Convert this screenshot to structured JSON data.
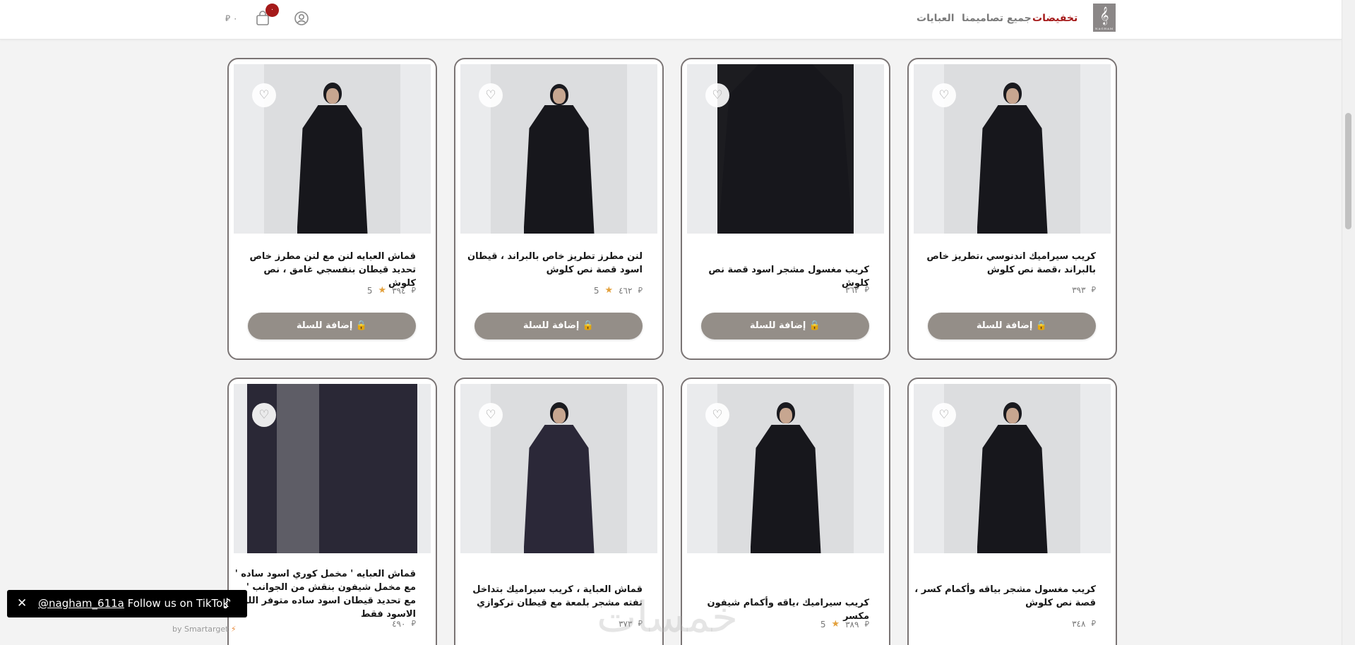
{
  "header": {
    "logo_mark": "𝄞",
    "logo_text": "NAGHAM",
    "nav": {
      "sale": "تخفيضات",
      "all_designs": "جميع تصاميمنا",
      "abayas": "العبايات"
    },
    "cart_count": "٠",
    "cart_total": "٠ ⃁",
    "icons": {
      "profile": "profile-icon",
      "cart": "shopping-bag-icon"
    }
  },
  "add_to_cart_label": "إضافة للسلة",
  "favorite_icon": "♡",
  "currency": "⃁",
  "star": "★",
  "products": [
    {
      "title": "كريب سيراميك اندنوسي ،تطريز خاص بالبراند ،قصة نص كلوش",
      "price": "٣٩٣",
      "rating": ""
    },
    {
      "title": "كريب مغسول مشجر اسود قصة نص كلوش",
      "price": "٣٦٢",
      "rating": ""
    },
    {
      "title": "لنن مطرز تطريز خاص بالبراند ، قيطان اسود قصة نص كلوش",
      "price": "٤٦٢",
      "rating": "5"
    },
    {
      "title": "قماش العبايه لنن مع لنن مطرز خاص تحديد قيطان بنفسجي غامق ، نص كلوش",
      "price": "٣٩٤",
      "rating": "5"
    },
    {
      "title": "كريب مغسول مشجر بياقه وأكمام كسر ، قصة نص كلوش",
      "price": "٣٤٨",
      "rating": ""
    },
    {
      "title": "كريب سيراميك ،ياقه وأكمام شيفون مكسر",
      "price": "٣٨٩",
      "rating": "5"
    },
    {
      "title": "قماش العباية ، كريب سيراميك بتداخل تفته مشجر بلمعة مع قيطان تركوازي",
      "price": "٣٧٣",
      "rating": ""
    },
    {
      "title": "قماش العبايه ' مخمل كوري اسود ساده ' مع مخمل شيفون بنقش من الجوانب ' مع تحديد قيطان اسود ساده متوفر اللون الاسود فقط",
      "price": "٤٩٠",
      "rating": ""
    }
  ],
  "tiktok": {
    "handle": "@nagham_611a",
    "text": "Follow us on TikTok",
    "close": "✕",
    "logo": "♪"
  },
  "powered_by": "by Smartarget",
  "watermark": "خمسات"
}
